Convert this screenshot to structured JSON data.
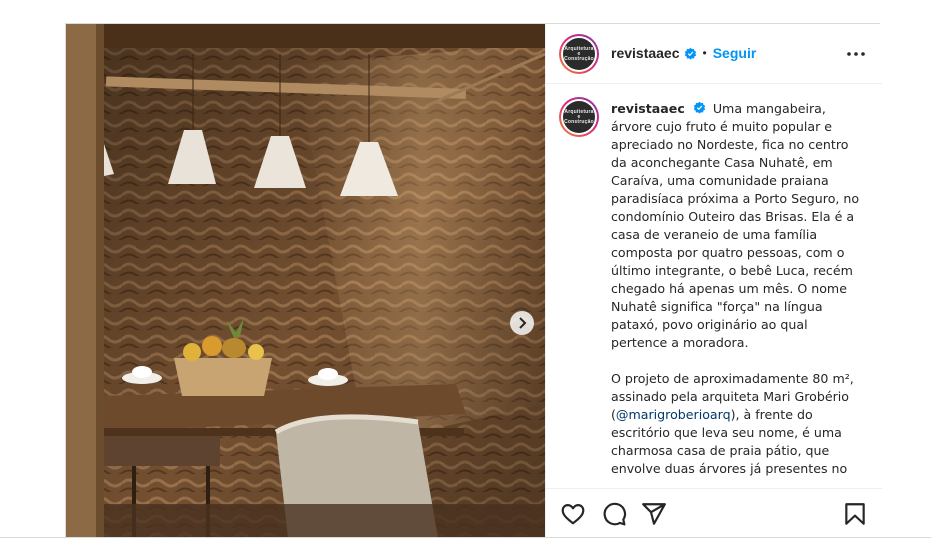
{
  "post": {
    "username": "revistaaec",
    "follow_label": "Seguir",
    "separator": "•",
    "avatar_text": "Arquitetura e Construção",
    "caption": {
      "paragraph1": "Uma mangabeira, árvore cujo fruto é muito popular e apreciado no Nordeste, fica no centro da aconchegante Casa Nuhatê, em Caraíva, uma comunidade praiana paradisíaca próxima a Porto Seguro, no condomínio Outeiro das Brisas. Ela é a casa de veraneio de uma família composta por quatro pessoas, com o último integrante, o bebê Luca, recém chegado há apenas um mês. O nome Nuhatê significa \"força\" na língua pataxó, povo originário ao qual pertence a moradora.",
      "paragraph2_start": "O projeto de aproximadamente 80 m², assinado pela arquiteta Mari Grobério (",
      "mention": "@marigroberioarq",
      "paragraph2_end": "), à frente do escritório que leva seu nome, é uma charmosa casa de praia pátio, que envolve duas árvores já presentes no"
    }
  },
  "icons": {
    "verified": "verified-badge-icon",
    "more": "more-options-icon",
    "like": "heart-icon",
    "comment": "comment-icon",
    "share": "send-icon",
    "save": "bookmark-icon",
    "next": "chevron-right-icon"
  },
  "colors": {
    "accent": "#0095f6",
    "mention": "#00376b",
    "border": "#dbdbdb"
  }
}
